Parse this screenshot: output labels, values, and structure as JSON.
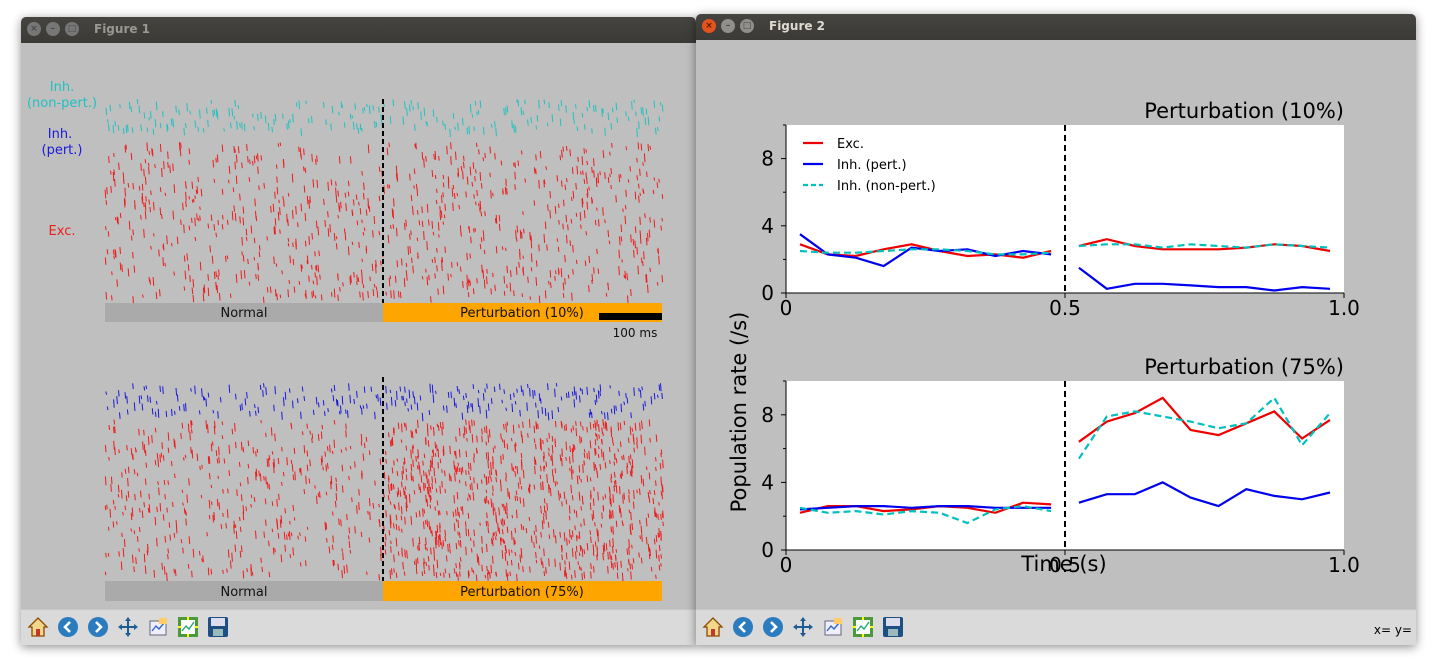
{
  "figure1": {
    "window_title": "Figure 1",
    "panels": [
      {
        "left_label": "Normal",
        "right_label": "Perturbation (10%)",
        "perturbation_percent": 10
      },
      {
        "left_label": "Normal",
        "right_label": "Perturbation (75%)",
        "perturbation_percent": 75
      }
    ],
    "labels": {
      "inh_nonpert_line1": "Inh.",
      "inh_nonpert_line2": "(non-pert.)",
      "inh_pert_line1": "Inh.",
      "inh_pert_line2": "(pert.)",
      "exc": "Exc."
    },
    "scalebar_label": "100 ms",
    "colors": {
      "exc": "#ee1c1c",
      "inh_pert": "#1a1adc",
      "inh_nonpert": "#22c0c0",
      "normal_bar": "#aaaaaa",
      "pert_bar": "#ffa500"
    }
  },
  "figure2": {
    "window_title": "Figure 2",
    "ylabel": "Population rate (/s)",
    "xlabel": "Time (s)",
    "coords_text": "x= y=",
    "legend": [
      "Exc.",
      "Inh. (pert.)",
      "Inh. (non-pert.)"
    ]
  },
  "toolbar": {
    "icons": [
      "home-icon",
      "back-icon",
      "forward-icon",
      "pan-icon",
      "configure-subplots-icon",
      "edit-axes-icon",
      "save-icon"
    ]
  },
  "chart_data": [
    {
      "type": "line",
      "title": "Perturbation (10%)",
      "xlabel": "",
      "ylabel": "Population rate (/s)",
      "xlim": [
        0,
        1.0
      ],
      "ylim": [
        0,
        10
      ],
      "xticks": [
        "0",
        "0.5",
        "1.0"
      ],
      "yticks": [
        "0",
        "4",
        "8"
      ],
      "vline_x": 0.5,
      "legend_position": "top-left",
      "series": [
        {
          "name": "Exc.",
          "color": "#ee0000",
          "dash": "solid",
          "segments": [
            {
              "x": [
                0.025,
                0.075,
                0.125,
                0.175,
                0.225,
                0.275,
                0.325,
                0.375,
                0.425,
                0.475
              ],
              "y": [
                2.9,
                2.3,
                2.2,
                2.6,
                2.9,
                2.5,
                2.2,
                2.3,
                2.1,
                2.5
              ]
            },
            {
              "x": [
                0.525,
                0.575,
                0.625,
                0.675,
                0.725,
                0.775,
                0.825,
                0.875,
                0.925,
                0.975
              ],
              "y": [
                2.8,
                3.2,
                2.8,
                2.6,
                2.6,
                2.6,
                2.7,
                2.9,
                2.8,
                2.5
              ]
            }
          ]
        },
        {
          "name": "Inh. (pert.)",
          "color": "#0000ee",
          "dash": "solid",
          "segments": [
            {
              "x": [
                0.025,
                0.075,
                0.125,
                0.175,
                0.225,
                0.275,
                0.325,
                0.375,
                0.425,
                0.475
              ],
              "y": [
                3.5,
                2.3,
                2.1,
                1.6,
                2.7,
                2.5,
                2.6,
                2.2,
                2.5,
                2.3
              ]
            },
            {
              "x": [
                0.525,
                0.575,
                0.625,
                0.675,
                0.725,
                0.775,
                0.825,
                0.875,
                0.925,
                0.975
              ],
              "y": [
                1.5,
                0.25,
                0.55,
                0.55,
                0.45,
                0.35,
                0.35,
                0.15,
                0.35,
                0.25
              ]
            }
          ]
        },
        {
          "name": "Inh. (non-pert.)",
          "color": "#00bfbf",
          "dash": "dashed",
          "segments": [
            {
              "x": [
                0.025,
                0.075,
                0.125,
                0.175,
                0.225,
                0.275,
                0.325,
                0.375,
                0.425,
                0.475
              ],
              "y": [
                2.5,
                2.4,
                2.4,
                2.5,
                2.6,
                2.6,
                2.5,
                2.3,
                2.3,
                2.4
              ]
            },
            {
              "x": [
                0.525,
                0.575,
                0.625,
                0.675,
                0.725,
                0.775,
                0.825,
                0.875,
                0.925,
                0.975
              ],
              "y": [
                2.8,
                2.9,
                2.9,
                2.7,
                2.9,
                2.8,
                2.7,
                2.9,
                2.8,
                2.7
              ]
            }
          ]
        }
      ]
    },
    {
      "type": "line",
      "title": "Perturbation (75%)",
      "xlabel": "Time (s)",
      "ylabel": "Population rate (/s)",
      "xlim": [
        0,
        1.0
      ],
      "ylim": [
        0,
        10
      ],
      "xticks": [
        "0",
        "0.5",
        "1.0"
      ],
      "yticks": [
        "0",
        "4",
        "8"
      ],
      "vline_x": 0.5,
      "series": [
        {
          "name": "Exc.",
          "color": "#ee0000",
          "dash": "solid",
          "segments": [
            {
              "x": [
                0.025,
                0.075,
                0.125,
                0.175,
                0.225,
                0.275,
                0.325,
                0.375,
                0.425,
                0.475
              ],
              "y": [
                2.2,
                2.6,
                2.6,
                2.3,
                2.4,
                2.6,
                2.5,
                2.2,
                2.8,
                2.7
              ]
            },
            {
              "x": [
                0.525,
                0.575,
                0.625,
                0.675,
                0.725,
                0.775,
                0.825,
                0.875,
                0.925,
                0.975
              ],
              "y": [
                6.4,
                7.6,
                8.1,
                9.0,
                7.1,
                6.8,
                7.5,
                8.2,
                6.6,
                7.7
              ]
            }
          ]
        },
        {
          "name": "Inh. (pert.)",
          "color": "#0000ee",
          "dash": "solid",
          "segments": [
            {
              "x": [
                0.025,
                0.075,
                0.125,
                0.175,
                0.225,
                0.275,
                0.325,
                0.375,
                0.425,
                0.475
              ],
              "y": [
                2.4,
                2.5,
                2.6,
                2.6,
                2.5,
                2.6,
                2.6,
                2.5,
                2.5,
                2.5
              ]
            },
            {
              "x": [
                0.525,
                0.575,
                0.625,
                0.675,
                0.725,
                0.775,
                0.825,
                0.875,
                0.925,
                0.975
              ],
              "y": [
                2.8,
                3.3,
                3.3,
                4.0,
                3.1,
                2.6,
                3.6,
                3.2,
                3.0,
                3.4
              ]
            }
          ]
        },
        {
          "name": "Inh. (non-pert.)",
          "color": "#00bfbf",
          "dash": "dashed",
          "segments": [
            {
              "x": [
                0.025,
                0.075,
                0.125,
                0.175,
                0.225,
                0.275,
                0.325,
                0.375,
                0.425,
                0.475
              ],
              "y": [
                2.5,
                2.2,
                2.3,
                2.1,
                2.3,
                2.2,
                1.6,
                2.4,
                2.6,
                2.3
              ]
            },
            {
              "x": [
                0.525,
                0.575,
                0.625,
                0.675,
                0.725,
                0.775,
                0.825,
                0.875,
                0.925,
                0.975
              ],
              "y": [
                5.4,
                7.9,
                8.2,
                7.9,
                7.6,
                7.2,
                7.5,
                9.0,
                6.2,
                8.1
              ]
            }
          ]
        }
      ]
    }
  ]
}
